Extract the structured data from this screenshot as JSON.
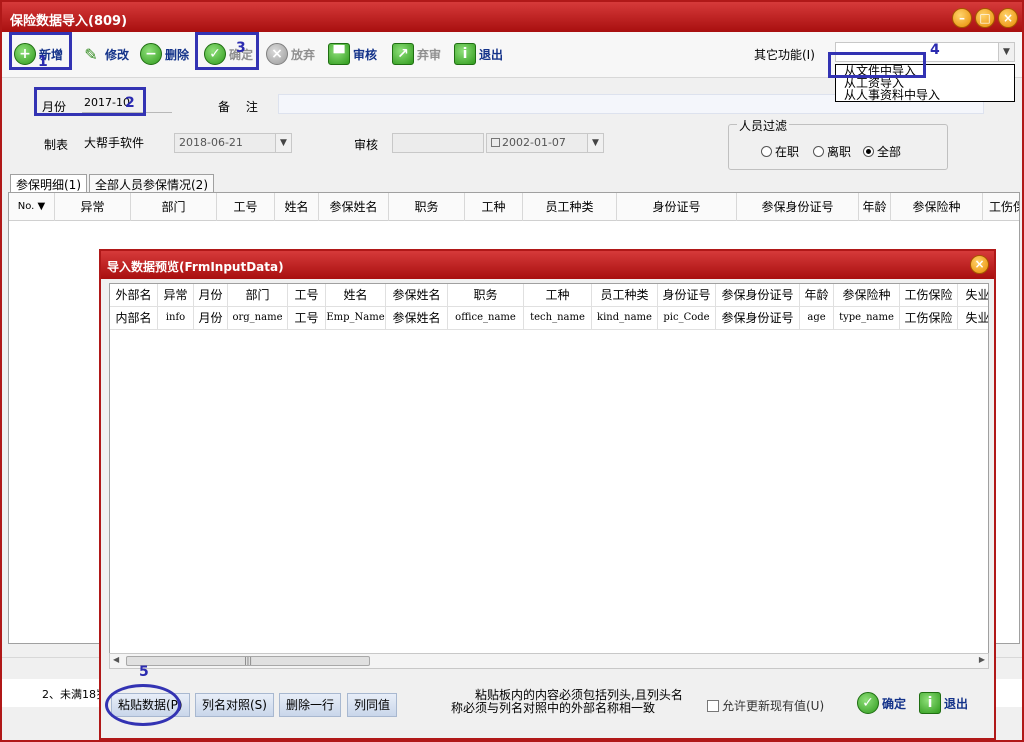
{
  "window": {
    "title": "保险数据导入(809)",
    "controls": {
      "minimize": "–",
      "maximize": "□",
      "close": "×"
    }
  },
  "toolbar": {
    "add": "新增",
    "edit": "修改",
    "delete": "删除",
    "confirm": "确定",
    "abandon": "放弃",
    "audit": "审核",
    "unaudit": "弃审",
    "exit": "退出",
    "other_functions_label": "其它功能(I)"
  },
  "other_menu": {
    "items": [
      "从文件中导入",
      "从工资导入",
      "从人事资料中导入"
    ]
  },
  "form": {
    "month_label": "月份",
    "month_value": "2017-10",
    "remark_label": "备 注",
    "remark_value": "",
    "maker_label": "制表",
    "maker_value": "大帮手软件",
    "maker_date": "2018-06-21",
    "auditor_label": "审核",
    "auditor_value": "",
    "audit_date": "2002-01-07"
  },
  "filter": {
    "title": "人员过滤",
    "options": [
      "在职",
      "离职",
      "全部"
    ],
    "selected": "全部"
  },
  "tabs": [
    "参保明细(1)",
    "全部人员参保情况(2)"
  ],
  "main_grid": {
    "columns": [
      "No.",
      "异常",
      "部门",
      "工号",
      "姓名",
      "参保姓名",
      "职务",
      "工种",
      "员工种类",
      "身份证号",
      "参保身份证号",
      "年龄",
      "参保险种",
      "工伤保"
    ]
  },
  "status": {
    "line2_text": "2、未满18岁"
  },
  "dialog": {
    "title": "导入数据预览(FrmInputData)",
    "external_row": [
      "外部名",
      "异常",
      "月份",
      "部门",
      "工号",
      "姓名",
      "参保姓名",
      "职务",
      "工种",
      "员工种类",
      "身份证号",
      "参保身份证号",
      "年龄",
      "参保险种",
      "工伤保险",
      "失业"
    ],
    "internal_row": [
      "内部名",
      "info",
      "月份",
      "org_name",
      "工号",
      "Emp_Name",
      "参保姓名",
      "office_name",
      "tech_name",
      "kind_name",
      "pic_Code",
      "参保身份证号",
      "age",
      "type_name",
      "工伤保险",
      "失业"
    ],
    "paste_button": "粘贴数据(P)",
    "colmap_button": "列名对照(S)",
    "delete_row_button": "删除一行",
    "same_value_button": "列同值",
    "note_line1": "粘贴板内的内容必须包括列头,且列头名",
    "note_line2": "称必须与列名对照中的外部名称相一致",
    "allow_update_label": "允许更新现有值(U)",
    "confirm": "确定",
    "exit": "退出"
  },
  "annotations": [
    "1",
    "2",
    "3",
    "4",
    "5"
  ],
  "colors": {
    "title_red": "#b01818",
    "highlight_blue": "#3333b3",
    "toolbar_text": "#14338a"
  }
}
